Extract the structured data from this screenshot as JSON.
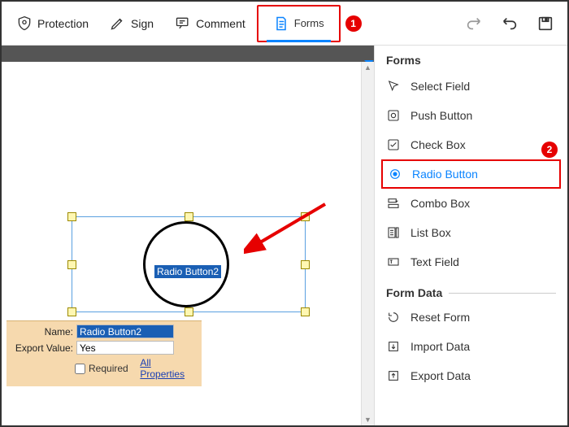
{
  "toolbar": {
    "protection": "Protection",
    "sign": "Sign",
    "comment": "Comment",
    "forms": "Forms"
  },
  "annotations": {
    "tab": "1",
    "radio": "2"
  },
  "side": {
    "title": "Forms",
    "items": {
      "select_field": "Select Field",
      "push_button": "Push Button",
      "check_box": "Check Box",
      "radio_button": "Radio Button",
      "combo_box": "Combo Box",
      "list_box": "List Box",
      "text_field": "Text Field"
    },
    "form_data": {
      "header": "Form Data",
      "reset": "Reset Form",
      "import": "Import Data",
      "export": "Export Data"
    }
  },
  "canvas": {
    "field_label": "Radio Button2"
  },
  "props": {
    "name_label": "Name:",
    "name_value": "Radio Button2",
    "export_label": "Export Value:",
    "export_value": "Yes",
    "required": "Required",
    "all_props": "All Properties"
  }
}
